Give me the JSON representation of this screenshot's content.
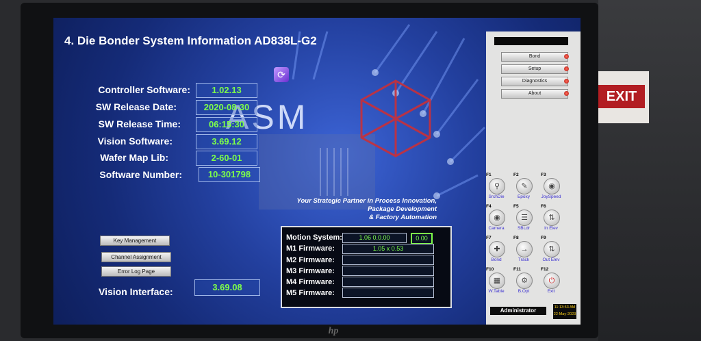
{
  "title": "4. Die Bonder System Information AD838L-G2",
  "info_rows": [
    {
      "label": "Controller Software:",
      "value": "1.02.13"
    },
    {
      "label": "SW Release Date:",
      "value": "2020-08-30"
    },
    {
      "label": "SW Release Time:",
      "value": "06:15:30"
    },
    {
      "label": "Vision Software:",
      "value": "3.69.12"
    },
    {
      "label": "Wafer Map Lib:",
      "value": "2-60-01"
    },
    {
      "label": "Software Number:",
      "value": "10-301798"
    }
  ],
  "brand": "ASM",
  "tagline": [
    "Your Strategic Partner in Process Innovation,",
    "Package Development",
    "&  Factory Automation"
  ],
  "left_buttons": {
    "key_management": "Key Management",
    "channel_assignment": "Channel Assignment",
    "error_log": "Error Log Page"
  },
  "vision_interface": {
    "label": "Vision Interface:",
    "value": "3.69.08"
  },
  "motion": {
    "motion_label": "Motion System:",
    "motion_value": "1.06 0.0.00",
    "motion_extra": "0.00",
    "firmwares": [
      {
        "label": "M1 Firmware:",
        "value": "1.05 x 0.53"
      },
      {
        "label": "M2 Firmware:",
        "value": ""
      },
      {
        "label": "M3 Firmware:",
        "value": ""
      },
      {
        "label": "M4 Firmware:",
        "value": ""
      },
      {
        "label": "M5 Firmware:",
        "value": ""
      }
    ]
  },
  "menu": [
    {
      "label": "Bond"
    },
    {
      "label": "Setup"
    },
    {
      "label": "Diagnostics"
    },
    {
      "label": "About"
    }
  ],
  "fkeys": [
    {
      "key": "F1",
      "caption": "SrchDie",
      "icon": "search-icon"
    },
    {
      "key": "F2",
      "caption": "Epoxy",
      "icon": "epoxy-icon"
    },
    {
      "key": "F3",
      "caption": "JoySpeed",
      "icon": "joystick-icon"
    },
    {
      "key": "F4",
      "caption": "Camera",
      "icon": "camera-icon"
    },
    {
      "key": "F5",
      "caption": "SBLdr",
      "icon": "loader-icon"
    },
    {
      "key": "F6",
      "caption": "In Elev",
      "icon": "elevator-in-icon"
    },
    {
      "key": "F7",
      "caption": "Bond",
      "icon": "bond-icon"
    },
    {
      "key": "F8",
      "caption": "Track",
      "icon": "track-icon"
    },
    {
      "key": "F9",
      "caption": "Out Elev",
      "icon": "elevator-out-icon"
    },
    {
      "key": "F10",
      "caption": "W.Table",
      "icon": "table-icon"
    },
    {
      "key": "F11",
      "caption": "B.Opt",
      "icon": "options-icon"
    },
    {
      "key": "F12",
      "caption": "Exit",
      "icon": "power-icon"
    }
  ],
  "status": {
    "user": "Administrator",
    "time": "11:13:53 AM",
    "date": "22-May-2023"
  },
  "environment": {
    "exit_sign": "EXIT",
    "monitor_logo": "hp"
  },
  "colors": {
    "screen_bg": "#1d3a96",
    "value_text": "#7dff4a",
    "panel_bg": "#e3e3e2"
  }
}
